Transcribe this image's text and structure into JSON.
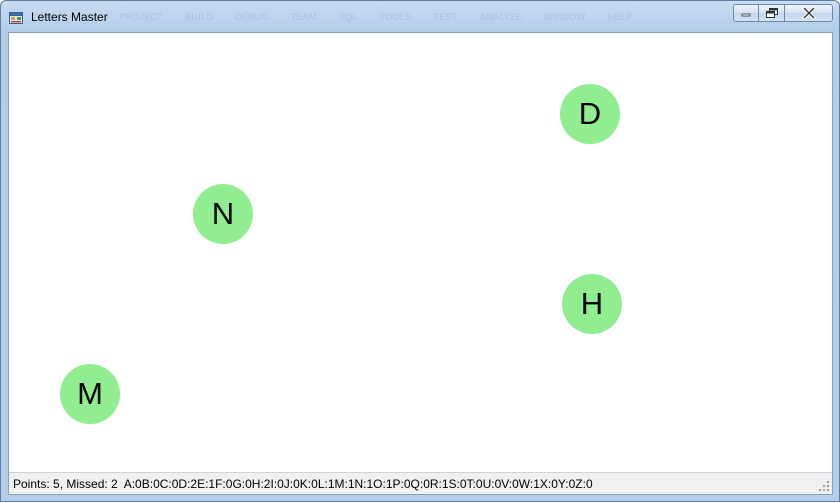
{
  "window": {
    "title": "Letters Master",
    "icon": "winforms-app-icon",
    "background_menu_ghost": [
      "PROJECT",
      "BUILD",
      "DEBUG",
      "TEAM",
      "SQL",
      "TOOLS",
      "TEST",
      "ANALYZE",
      "WINDOW",
      "HELP"
    ]
  },
  "controls": {
    "minimize": "minimize-icon",
    "restore": "restore-icon",
    "close": "close-icon"
  },
  "game": {
    "ball_color": "#90ee90",
    "letters": [
      {
        "id": "D",
        "label": "D"
      },
      {
        "id": "N",
        "label": "N"
      },
      {
        "id": "H",
        "label": "H"
      },
      {
        "id": "M",
        "label": "M"
      }
    ]
  },
  "status": {
    "summary": "Points: 5, Missed: 2",
    "letter_counts": "A:0B:0C:0D:2E:1F:0G:0H:2I:0J:0K:0L:1M:1N:1O:1P:0Q:0R:1S:0T:0U:0V:0W:1X:0Y:0Z:0"
  }
}
